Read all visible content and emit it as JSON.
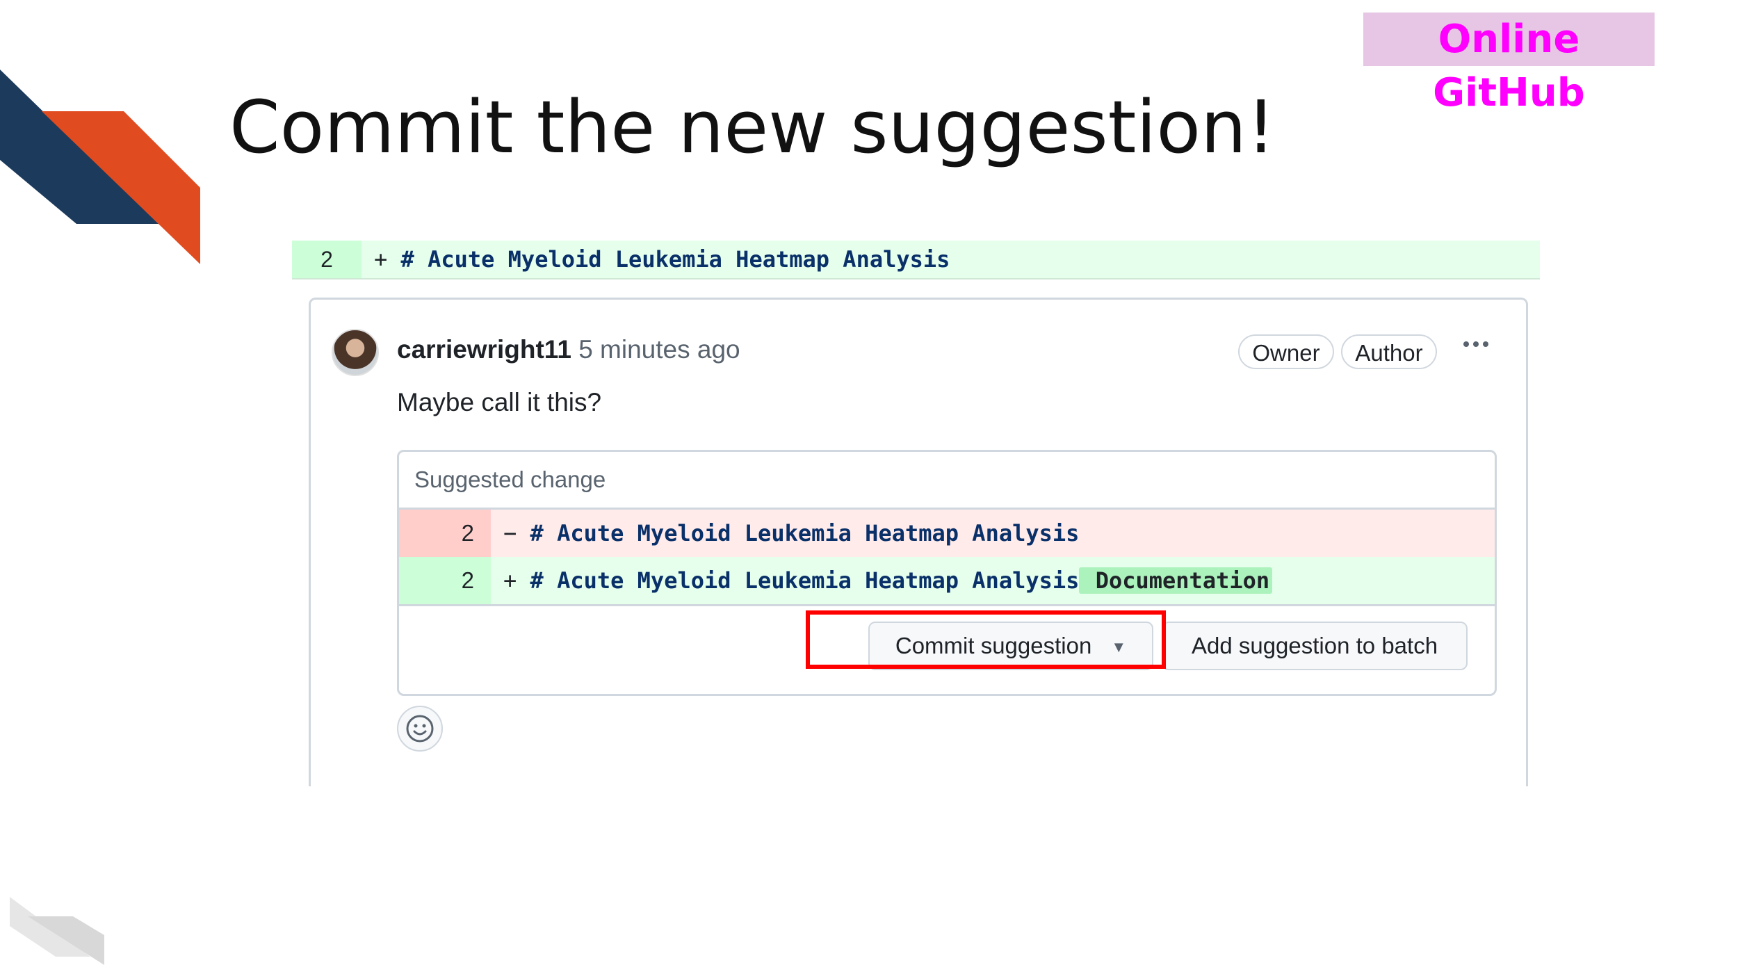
{
  "badge": {
    "label": "Online GitHub"
  },
  "slide": {
    "title": "Commit the new suggestion!"
  },
  "diff_line": {
    "line_number": "2",
    "sign": "+",
    "code": "# Acute Myeloid Leukemia Heatmap Analysis"
  },
  "comment": {
    "author": "carriewright11",
    "time": "5 minutes ago",
    "badges": [
      "Owner",
      "Author"
    ],
    "menu_icon": "kebab-horizontal-icon",
    "body": "Maybe call it this?"
  },
  "suggestion": {
    "header": "Suggested change",
    "removed": {
      "line_number": "2",
      "sign": "−",
      "code": "# Acute Myeloid Leukemia Heatmap Analysis"
    },
    "added": {
      "line_number": "2",
      "sign": "+",
      "code": "# Acute Myeloid Leukemia Heatmap Analysis",
      "highlight": " Documentation"
    },
    "commit_button": "Commit suggestion",
    "batch_button": "Add suggestion to batch"
  },
  "reaction": {
    "icon": "smiley-icon"
  },
  "colors": {
    "badge_bg": "#e6c6e4",
    "badge_text": "#ff00ff",
    "deco_navy": "#1b3a5c",
    "deco_orange": "#e14b20",
    "highlight_red": "#ff0000",
    "diff_added_bg": "#e6ffec",
    "diff_removed_bg": "#ffebe9"
  }
}
